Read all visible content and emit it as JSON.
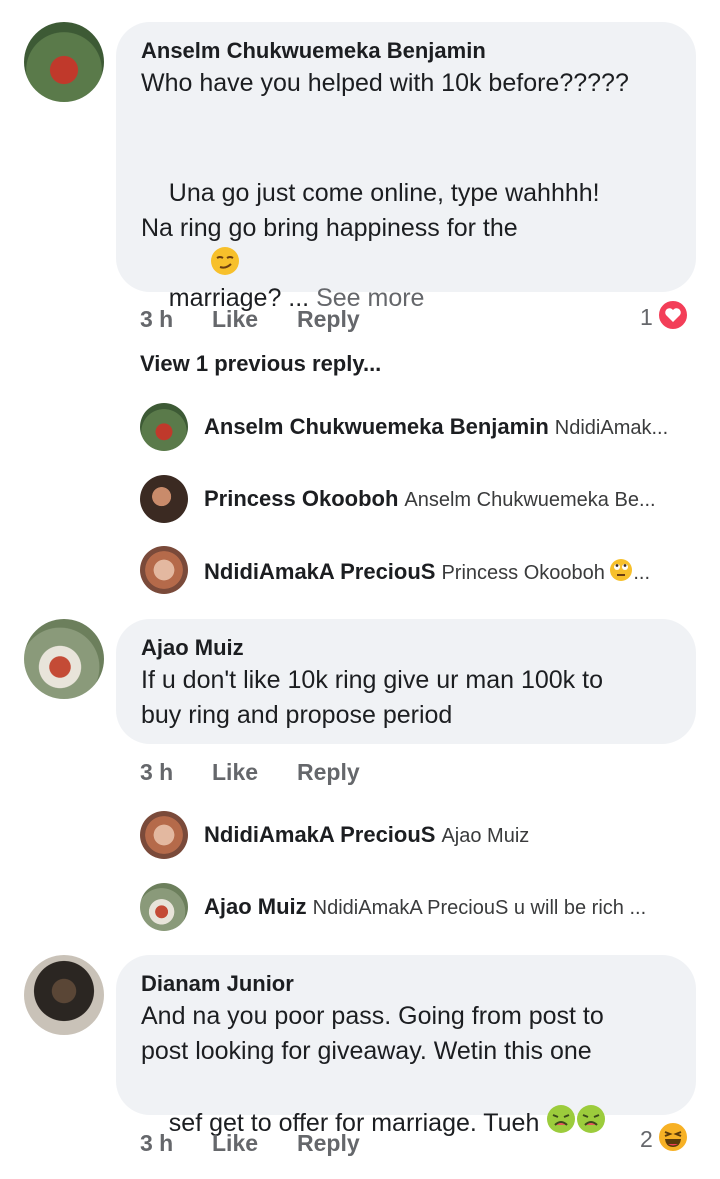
{
  "comments": [
    {
      "author": "Anselm Chukwuemeka Benjamin",
      "line1": "Who have you helped with 10k before?????",
      "line2": "Una go just come online, type wahhhh!",
      "line3a": "Na ring go bring happiness for the",
      "line3b": "marriage? ... ",
      "see_more": "See more",
      "time": "3 h",
      "like": "Like",
      "reply": "Reply",
      "reaction_count": "1",
      "reaction": "heart-icon",
      "view_previous": "View 1 previous reply...",
      "replies": [
        {
          "name": "Anselm Chukwuemeka Benjamin",
          "text": "NdidiAmak..."
        },
        {
          "name": "Princess Okooboh",
          "text": "Anselm Chukwuemeka Be..."
        },
        {
          "name": "NdidiAmakA PreciouS",
          "text": "Princess Okooboh",
          "tail": "..."
        }
      ]
    },
    {
      "author": "Ajao Muiz",
      "line1": "If u don't like 10k ring give ur man 100k to",
      "line2": "buy ring and propose period",
      "time": "3 h",
      "like": "Like",
      "reply": "Reply",
      "replies": [
        {
          "name": "NdidiAmakA PreciouS",
          "text": "Ajao Muiz"
        },
        {
          "name": "Ajao Muiz",
          "text": "NdidiAmakA PreciouS u will be rich ..."
        }
      ]
    },
    {
      "author": "Dianam Junior",
      "line1": "And na you poor pass. Going from post to",
      "line2": "post looking for giveaway. Wetin this one",
      "line3": "sef get to offer for marriage. Tueh ",
      "time": "3 h",
      "like": "Like",
      "reply": "Reply",
      "reaction_count": "2",
      "reaction": "haha-icon"
    }
  ],
  "colors": {
    "bubble": "#f0f2f5",
    "meta_text": "#65676b",
    "heart": "#f33e58",
    "haha": "#f7b125"
  }
}
